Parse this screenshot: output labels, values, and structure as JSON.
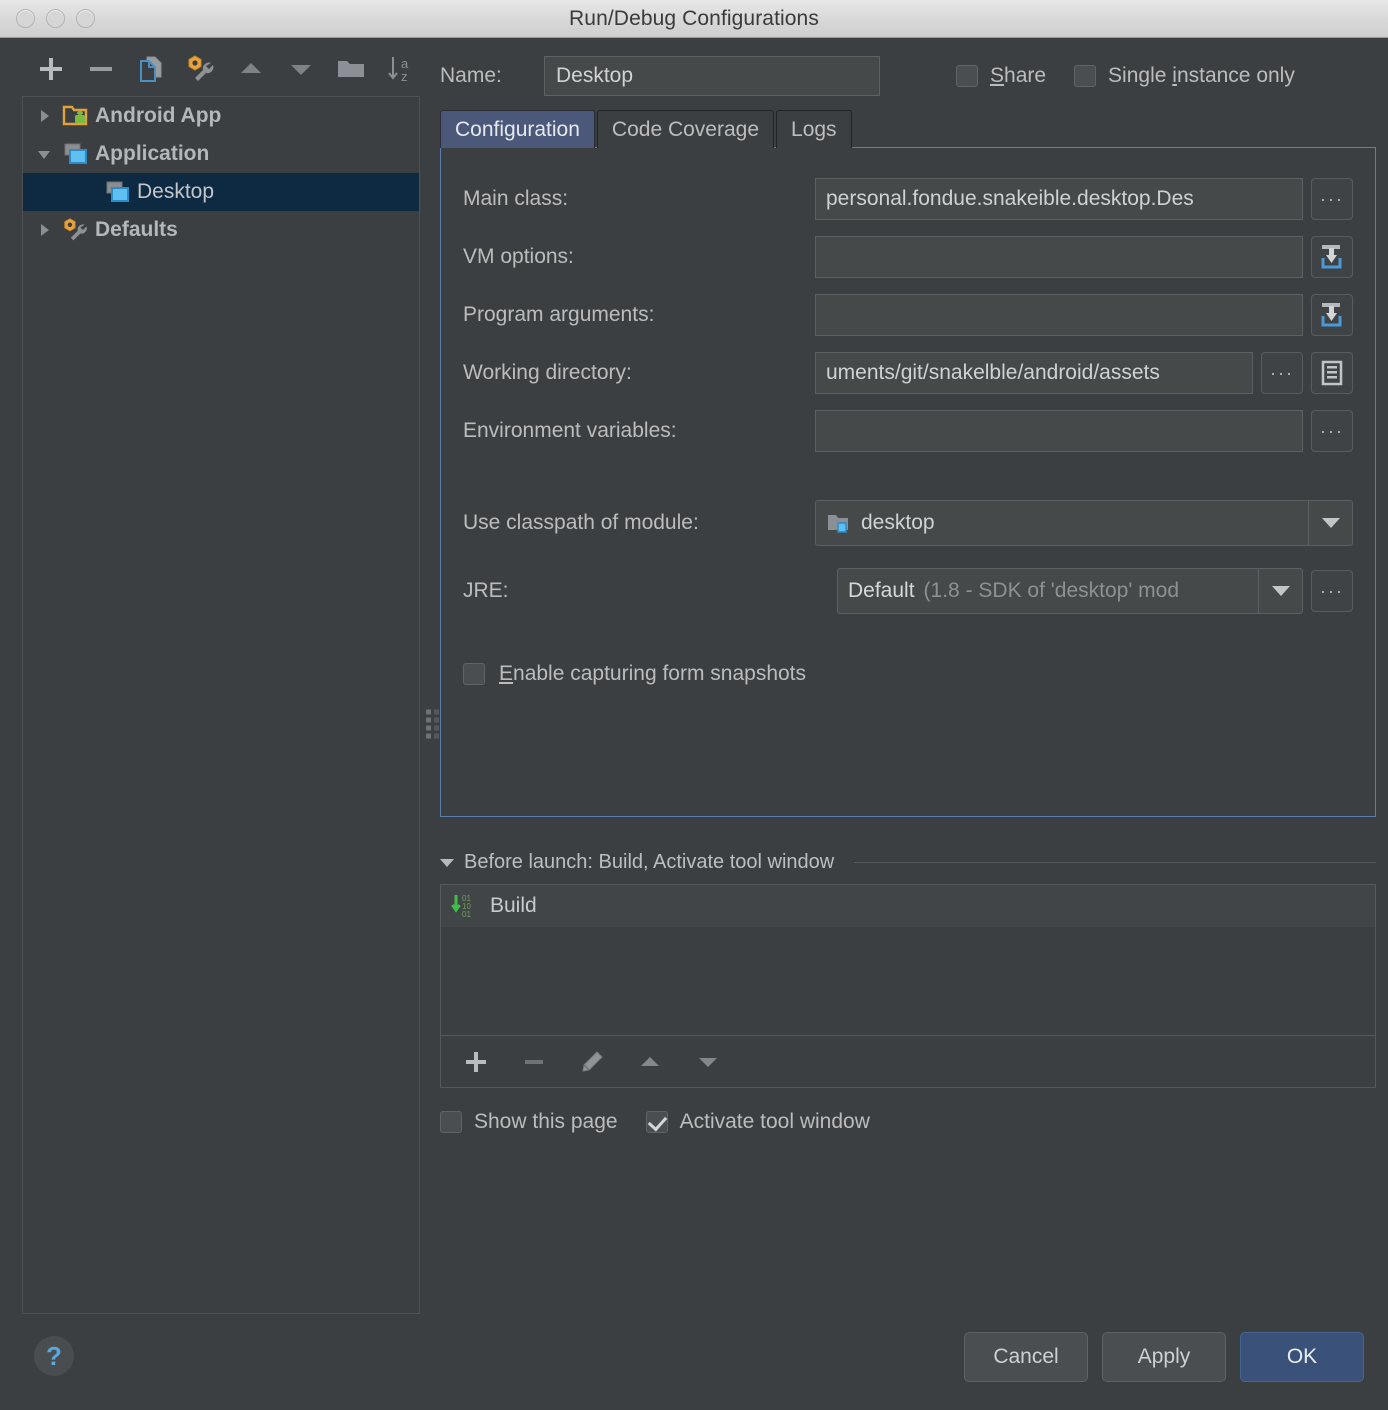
{
  "window": {
    "title": "Run/Debug Configurations",
    "traffic_lights": [
      "close-button",
      "minimize-button",
      "zoom-button"
    ]
  },
  "sidebar": {
    "toolbar": [
      {
        "name": "add-configuration-button",
        "icon": "plus-icon",
        "label": "+"
      },
      {
        "name": "remove-configuration-button",
        "icon": "minus-icon",
        "label": "−"
      },
      {
        "name": "copy-configuration-button",
        "icon": "copy-icon",
        "label": ""
      },
      {
        "name": "edit-defaults-button",
        "icon": "wrench-icon",
        "label": ""
      },
      {
        "name": "move-up-button",
        "icon": "arrow-up-icon",
        "label": ""
      },
      {
        "name": "move-down-button",
        "icon": "arrow-down-icon",
        "label": ""
      },
      {
        "name": "create-folder-button",
        "icon": "folder-icon",
        "label": ""
      },
      {
        "name": "sort-alphabetically-button",
        "icon": "sort-az-icon",
        "label": ""
      }
    ],
    "tree": [
      {
        "label": "Android App",
        "icon": "android-folder-icon",
        "expanded": false,
        "level": 0,
        "selected": false
      },
      {
        "label": "Application",
        "icon": "application-icon",
        "expanded": true,
        "level": 0,
        "selected": false
      },
      {
        "label": "Desktop",
        "icon": "application-icon",
        "level": 1,
        "selected": true
      },
      {
        "label": "Defaults",
        "icon": "wrench-icon",
        "expanded": false,
        "level": 0,
        "selected": false
      }
    ]
  },
  "header": {
    "name_label": "Name:",
    "name_value": "Desktop",
    "share": {
      "label": "Share",
      "mnemonic": "S",
      "checked": false
    },
    "single_instance": {
      "label": "Single instance only",
      "label_pre": "Single ",
      "mnemonic": "i",
      "label_post": "nstance only",
      "checked": false
    }
  },
  "tabs": [
    {
      "label": "Configuration",
      "active": true
    },
    {
      "label": "Code Coverage",
      "active": false
    },
    {
      "label": "Logs",
      "active": false
    }
  ],
  "configuration": {
    "main_class": {
      "label": "Main class:",
      "value": "personal.fondue.snakeible.desktop.Des",
      "browse": "···"
    },
    "vm_options": {
      "label": "VM options:",
      "value": "",
      "expand_icon": "expand-editor-icon"
    },
    "program_arguments": {
      "label": "Program arguments:",
      "value": "",
      "expand_icon": "expand-editor-icon"
    },
    "working_directory": {
      "label": "Working directory:",
      "value": "uments/git/snakelble/android/assets",
      "browse": "···",
      "macro_icon": "insert-macro-icon"
    },
    "environment_variables": {
      "label": "Environment variables:",
      "value": "",
      "browse": "···"
    },
    "classpath_module": {
      "label": "Use classpath of module:",
      "value": "desktop",
      "icon": "module-folder-icon"
    },
    "jre": {
      "label": "JRE:",
      "value_strong": "Default",
      "value_dim": "(1.8 - SDK of 'desktop' mod",
      "browse": "···"
    },
    "form_snapshots": {
      "label": "Enable capturing form snapshots",
      "label_pre": "",
      "mnemonic": "E",
      "label_post": "nable capturing form snapshots",
      "checked": false
    }
  },
  "before_launch": {
    "title": "Before launch: Build, Activate tool window",
    "items": [
      {
        "label": "Build",
        "icon": "build-icon"
      }
    ],
    "toolbar": [
      {
        "name": "add-task-button",
        "icon": "plus-icon"
      },
      {
        "name": "remove-task-button",
        "icon": "minus-icon"
      },
      {
        "name": "edit-task-button",
        "icon": "pencil-icon"
      },
      {
        "name": "move-task-up-button",
        "icon": "arrow-up-icon"
      },
      {
        "name": "move-task-down-button",
        "icon": "arrow-down-icon"
      }
    ],
    "show_this_page": {
      "label": "Show this page",
      "checked": false
    },
    "activate_tool_window": {
      "label": "Activate tool window",
      "checked": true
    }
  },
  "footer": {
    "help": "?",
    "cancel": "Cancel",
    "apply": "Apply",
    "ok": "OK"
  },
  "colors": {
    "background": "#3c3f41",
    "panel_border": "#56595b",
    "field_background": "#45494a",
    "selection": "#0e2a42",
    "tab_active": "#4b587a",
    "accent_blue": "#5a7dab",
    "primary_button": "#3a527a",
    "help_blue": "#58a7dd",
    "build_green": "#4caf50",
    "titlebar": "#d8d8d8"
  }
}
